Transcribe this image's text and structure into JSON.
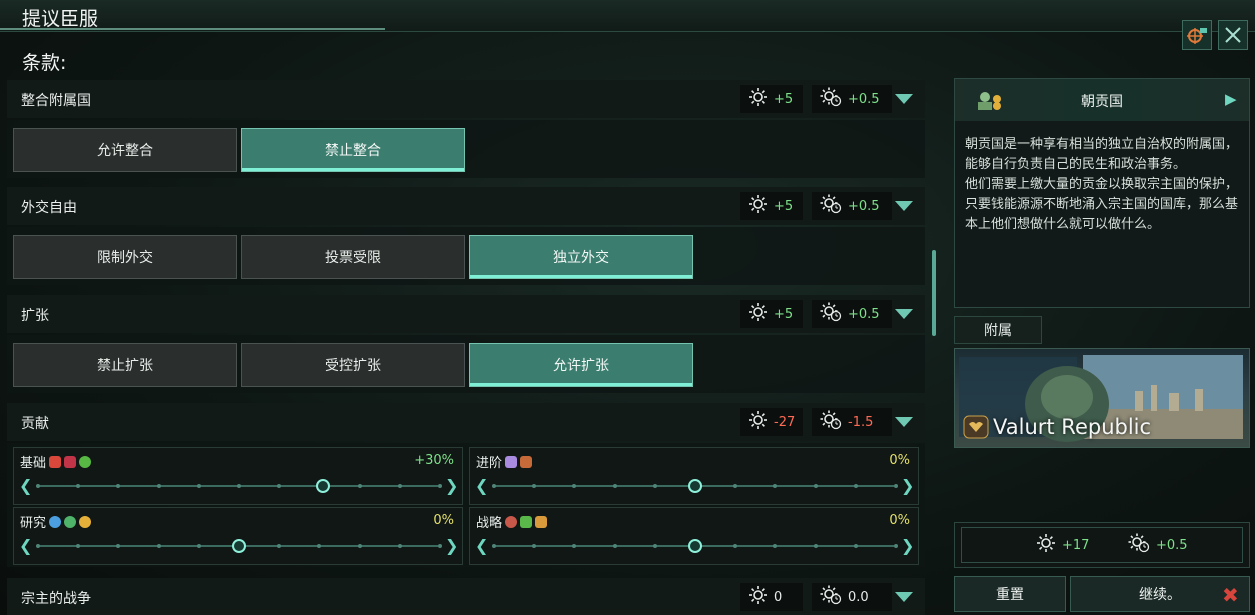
{
  "window": {
    "title": "提议臣服",
    "terms_label": "条款:"
  },
  "terms": [
    {
      "name": "整合附属国",
      "mod_a": "+5",
      "mod_b": "+0.5",
      "options": [
        "允许整合",
        "禁止整合"
      ],
      "selected": 1
    },
    {
      "name": "外交自由",
      "mod_a": "+5",
      "mod_b": "+0.5",
      "options": [
        "限制外交",
        "投票受限",
        "独立外交"
      ],
      "selected": 2
    },
    {
      "name": "扩张",
      "mod_a": "+5",
      "mod_b": "+0.5",
      "options": [
        "禁止扩张",
        "受控扩张",
        "允许扩张"
      ],
      "selected": 2
    },
    {
      "name": "贡献",
      "mod_a": "-27",
      "mod_b": "-1.5"
    },
    {
      "name": "宗主的战争",
      "mod_a": "0",
      "mod_b": "0.0"
    }
  ],
  "contribution_sliders": [
    {
      "label": "基础",
      "percent": "+30%",
      "value_fraction": 0.71
    },
    {
      "label": "进阶",
      "percent": "0%",
      "value_fraction": 0.5
    },
    {
      "label": "研究",
      "percent": "0%",
      "value_fraction": 0.5
    },
    {
      "label": "战略",
      "percent": "0%",
      "value_fraction": 0.5
    }
  ],
  "info": {
    "title": "朝贡国",
    "description": "朝贡国是一种享有相当的独立自治权的附属国，能够自行负责自己的民生和政治事务。\n他们需要上缴大量的贡金以换取宗主国的保护，只要钱能源源不断地涌入宗主国的国库，那么基本上他们想做什么就可以做什么。"
  },
  "subject": {
    "tab_label": "附属",
    "country_name": "Valurt Republic"
  },
  "summary": {
    "mod_a": "+17",
    "mod_b": "+0.5"
  },
  "buttons": {
    "reset": "重置",
    "continue": "继续。"
  },
  "colors": {
    "accent": "#3b7d6e",
    "positive": "#7ee08a",
    "negative": "#ff6a55"
  }
}
